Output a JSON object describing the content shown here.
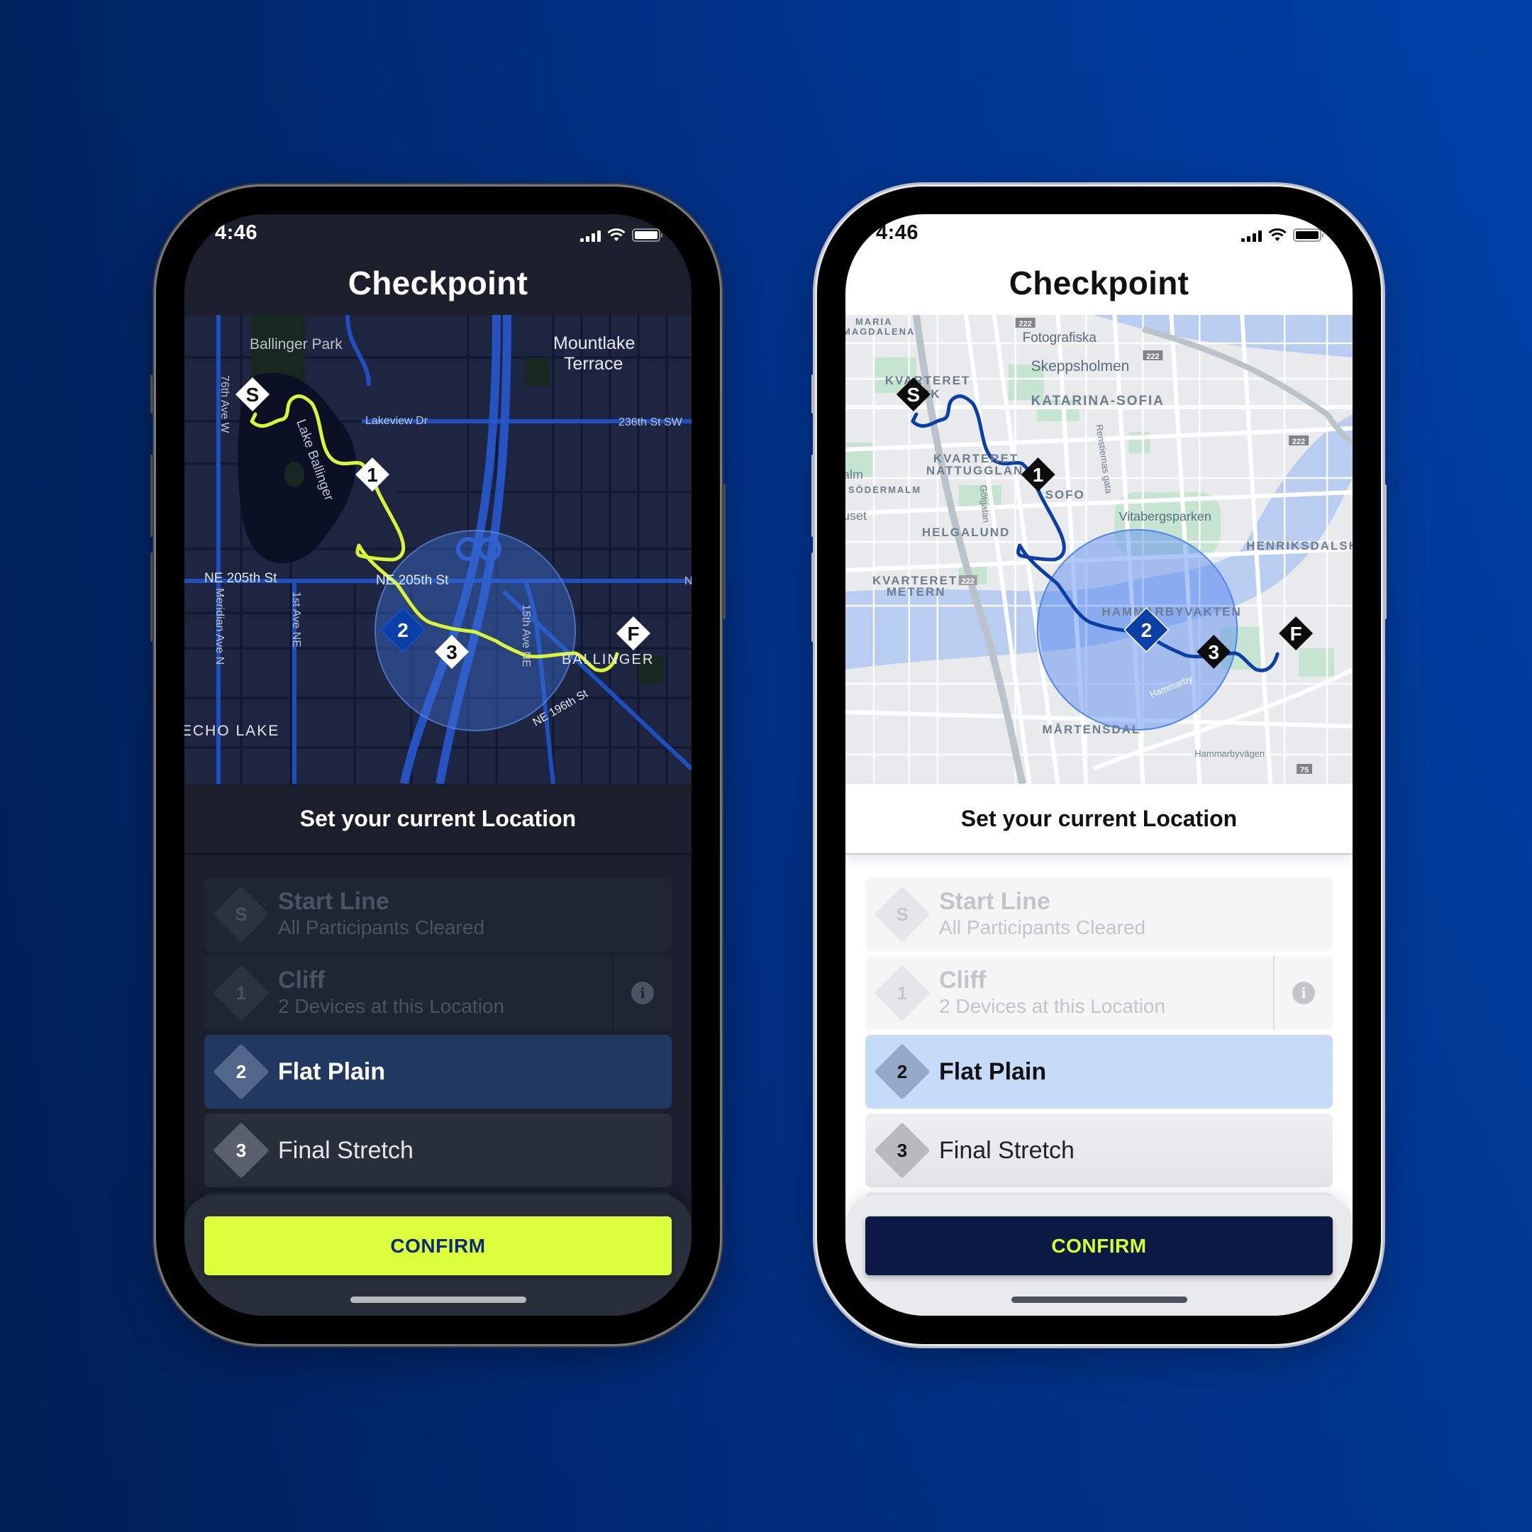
{
  "background": {
    "gradient_start": "#00235f",
    "gradient_end": "#0041a8"
  },
  "phones": [
    {
      "theme": "dark",
      "status_bar": {
        "time": "4:46",
        "icons": [
          "signal-icon",
          "wifi-icon",
          "battery-icon"
        ]
      },
      "title": "Checkpoint",
      "map": {
        "route_color": "#d8f53a",
        "labels": [
          "Ballinger Park",
          "Mountlake",
          "Terrace",
          "76th Ave W",
          "Lakeview Dr",
          "236th St SW",
          "Lake Ballinger",
          "NE 205th St",
          "NE 205th St",
          "Meridian Ave N",
          "1st Ave NE",
          "15th Ave NE",
          "BALLINGER",
          "NE 196th St",
          "ECHO LAKE",
          "N"
        ],
        "markers": [
          {
            "label": "S",
            "kind": "start"
          },
          {
            "label": "1",
            "kind": "checkpoint"
          },
          {
            "label": "2",
            "kind": "selected"
          },
          {
            "label": "3",
            "kind": "checkpoint"
          },
          {
            "label": "F",
            "kind": "finish"
          }
        ]
      },
      "subtitle": "Set your current Location",
      "items": [
        {
          "marker": "S",
          "title": "Start Line",
          "subtitle": "All Participants Cleared",
          "state": "done"
        },
        {
          "marker": "1",
          "title": "Cliff",
          "subtitle": "2 Devices at this Location",
          "state": "done",
          "info": true
        },
        {
          "marker": "2",
          "title": "Flat Plain",
          "state": "active"
        },
        {
          "marker": "3",
          "title": "Final Stretch",
          "state": "normal"
        }
      ],
      "confirm_label": "CONFIRM",
      "accent": "#dbff3b"
    },
    {
      "theme": "light",
      "status_bar": {
        "time": "4:46",
        "icons": [
          "signal-icon",
          "wifi-icon",
          "battery-icon"
        ]
      },
      "title": "Checkpoint",
      "map": {
        "route_color": "#0a3fa8",
        "labels": [
          "MARIA",
          "MAGDALENA",
          "222",
          "Fotografiska",
          "222",
          "Skeppsholmen",
          "KVARTERET",
          "PARK",
          "KATARINA-SOFIA",
          "222",
          "Renstiernas gata",
          "KVARTERET",
          "NATTUGGLAN",
          "alm",
          "SÖDERMALM",
          "Götgatan",
          "SOFO",
          "uset",
          "Vitabergsparken",
          "HELGALUND",
          "HENRIKSDALSH",
          "KVARTERET",
          "222",
          "METERN",
          "HAMMARBYVAKTEN",
          "Hammarby",
          "MÅRTENSDAL",
          "Hammarbyvägen",
          "75"
        ],
        "markers": [
          {
            "label": "S",
            "kind": "start"
          },
          {
            "label": "1",
            "kind": "checkpoint"
          },
          {
            "label": "2",
            "kind": "selected"
          },
          {
            "label": "3",
            "kind": "checkpoint"
          },
          {
            "label": "F",
            "kind": "finish"
          }
        ]
      },
      "subtitle": "Set your current Location",
      "items": [
        {
          "marker": "S",
          "title": "Start Line",
          "subtitle": "All Participants Cleared",
          "state": "done"
        },
        {
          "marker": "1",
          "title": "Cliff",
          "subtitle": "2 Devices at this Location",
          "state": "done",
          "info": true
        },
        {
          "marker": "2",
          "title": "Flat Plain",
          "state": "active"
        },
        {
          "marker": "3",
          "title": "Final Stretch",
          "state": "normal"
        }
      ],
      "confirm_label": "CONFIRM",
      "accent": "#0a1a45"
    }
  ]
}
